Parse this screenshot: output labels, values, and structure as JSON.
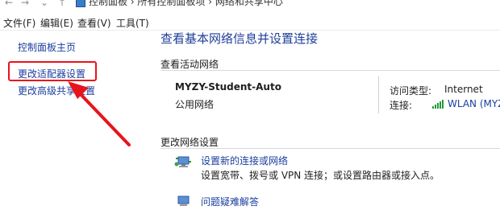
{
  "address": {
    "crumbs": "控制面板  ›  所有控制面板项  ›  网络和共享中心"
  },
  "menu": {
    "file": "文件(F)",
    "edit": "编辑(E)",
    "view": "查看(V)",
    "tools": "工具(T)"
  },
  "sidebar": {
    "home": "控制面板主页",
    "adapter": "更改适配器设置",
    "advanced": "更改高级共享设置"
  },
  "main": {
    "title": "查看基本网络信息并设置连接",
    "active_section": "查看活动网络",
    "network_name": "MYZY-Student-Auto",
    "network_type": "公用网络",
    "access_type_label": "访问类型:",
    "access_type_value": "Internet",
    "connection_label": "连接:",
    "connection_value": "WLAN (MYZY-",
    "change_section": "更改网络设置",
    "setup_link": "设置新的连接或网络",
    "setup_desc": "设置宽带、拨号或 VPN 连接；或设置路由器或接入点。",
    "troubleshoot_link": "问题疑难解答"
  },
  "colors": {
    "link": "#1a3e9f",
    "annotation": "#e8141c",
    "signal": "#1e9b3a"
  }
}
